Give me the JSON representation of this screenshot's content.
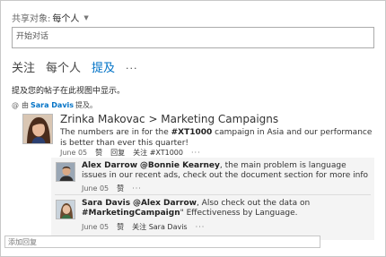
{
  "share": {
    "label": "共享对象:",
    "value": "每个人"
  },
  "compose": {
    "placeholder": "开始对话"
  },
  "tabs": [
    {
      "label": "关注"
    },
    {
      "label": "每个人"
    },
    {
      "label": "提及"
    },
    {
      "label": "···"
    }
  ],
  "notice": "提及您的帖子在此视图中显示。",
  "mentioned": {
    "prefix": "由",
    "user": "Sara Davis",
    "suffix": "提及。"
  },
  "post": {
    "title": "Zrinka Makovac > Marketing Campaigns",
    "body_pre": "The numbers are in for the ",
    "body_tag": "#XT1000",
    "body_post": " campaign in Asia and our performance is better than ever this quarter!",
    "date": "June 05",
    "like": "赞",
    "reply": "回复",
    "follow": "关注 #XT1000",
    "more": "···"
  },
  "replies": [
    {
      "author": "Alex Darrow",
      "mention": "@Bonnie Kearney",
      "text": ", the main problem is language issues in our recent ads, check out the document section for more info",
      "date": "June 05",
      "like": "赞",
      "more": "···"
    },
    {
      "author": "Sara Davis",
      "mention": "@Alex Darrow",
      "text_pre": ", Also check out the data on ",
      "tag": "#MarketingCampaign",
      "text_post": "\" Effectiveness by Language.",
      "date": "June 05",
      "like": "赞",
      "follow": "关注 Sara Davis",
      "more": "···"
    }
  ],
  "reply_box": {
    "placeholder": "添加回复"
  }
}
